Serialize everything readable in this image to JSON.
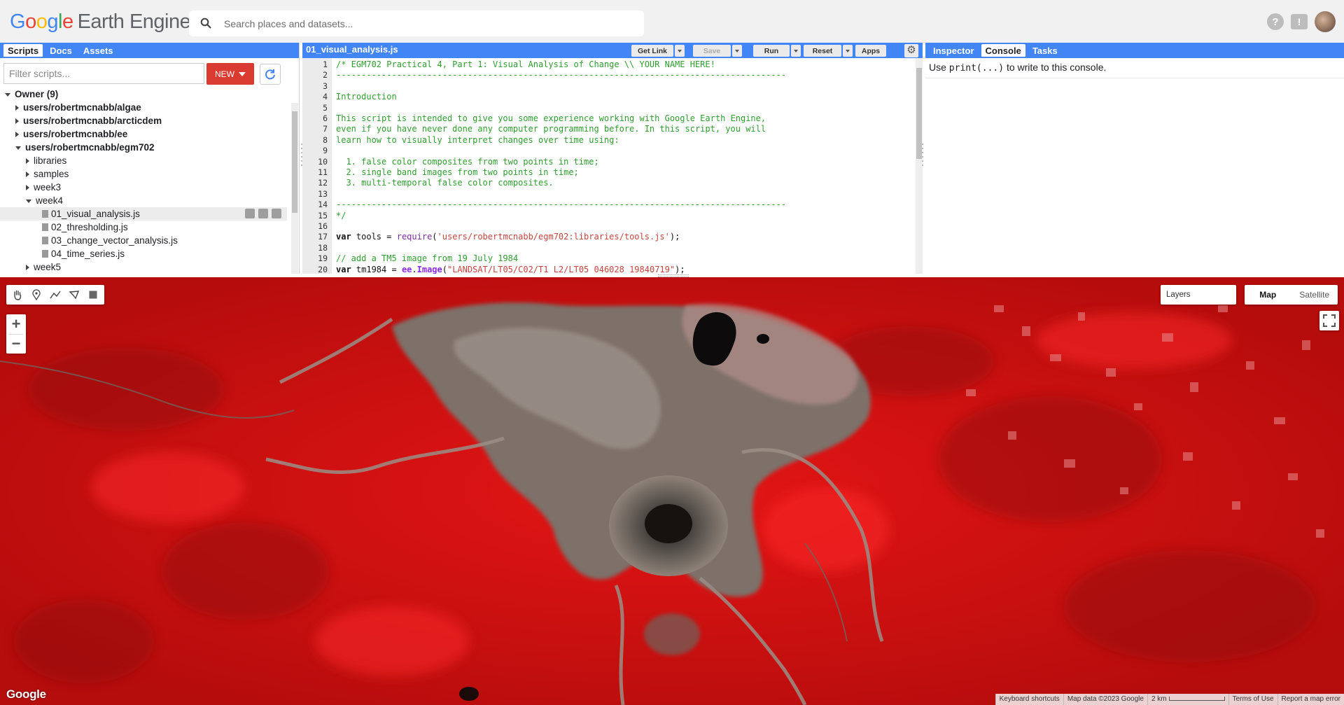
{
  "app": {
    "logo_google": [
      "G",
      "o",
      "o",
      "g",
      "l",
      "e"
    ],
    "logo_product": "Earth Engine",
    "search_placeholder": "Search places and datasets..."
  },
  "left_panel": {
    "tabs": [
      "Scripts",
      "Docs",
      "Assets"
    ],
    "active_tab": "Scripts",
    "filter_placeholder": "Filter scripts...",
    "new_label": "NEW",
    "tree": [
      {
        "label": "Owner (9)",
        "depth": 0,
        "state": "open",
        "bold": true,
        "kind": "folder"
      },
      {
        "label": "users/robertmcnabb/algae",
        "depth": 1,
        "state": "closed",
        "bold": true,
        "kind": "folder"
      },
      {
        "label": "users/robertmcnabb/arcticdem",
        "depth": 1,
        "state": "closed",
        "bold": true,
        "kind": "folder"
      },
      {
        "label": "users/robertmcnabb/ee",
        "depth": 1,
        "state": "closed",
        "bold": true,
        "kind": "folder"
      },
      {
        "label": "users/robertmcnabb/egm702",
        "depth": 1,
        "state": "open",
        "bold": true,
        "kind": "folder"
      },
      {
        "label": "libraries",
        "depth": 2,
        "state": "closed",
        "bold": false,
        "kind": "folder"
      },
      {
        "label": "samples",
        "depth": 2,
        "state": "closed",
        "bold": false,
        "kind": "folder"
      },
      {
        "label": "week3",
        "depth": 2,
        "state": "closed",
        "bold": false,
        "kind": "folder"
      },
      {
        "label": "week4",
        "depth": 2,
        "state": "open",
        "bold": false,
        "kind": "folder"
      },
      {
        "label": "01_visual_analysis.js",
        "depth": 3,
        "state": "file",
        "bold": false,
        "kind": "file",
        "selected": true
      },
      {
        "label": "02_thresholding.js",
        "depth": 3,
        "state": "file",
        "bold": false,
        "kind": "file"
      },
      {
        "label": "03_change_vector_analysis.js",
        "depth": 3,
        "state": "file",
        "bold": false,
        "kind": "file"
      },
      {
        "label": "04_time_series.js",
        "depth": 3,
        "state": "file",
        "bold": false,
        "kind": "file"
      },
      {
        "label": "week5",
        "depth": 2,
        "state": "closed",
        "bold": false,
        "kind": "folder"
      }
    ]
  },
  "editor": {
    "filename": "01_visual_analysis.js",
    "buttons": {
      "get_link": "Get Link",
      "save": "Save",
      "run": "Run",
      "reset": "Reset",
      "apps": "Apps"
    },
    "lines": [
      [
        {
          "t": "/* EGM702 Practical 4, Part 1: Visual Analysis of Change \\\\ YOUR NAME HERE!",
          "c": "cm"
        }
      ],
      [
        {
          "t": "-----------------------------------------------------------------------------------------",
          "c": "cm"
        }
      ],
      [],
      [
        {
          "t": "Introduction",
          "c": "cm"
        }
      ],
      [],
      [
        {
          "t": "This script is intended to give you some experience working with Google Earth Engine,",
          "c": "cm"
        }
      ],
      [
        {
          "t": "even if you have never done any computer programming before. In this script, you will",
          "c": "cm"
        }
      ],
      [
        {
          "t": "learn how to visually interpret changes over time using:",
          "c": "cm"
        }
      ],
      [],
      [
        {
          "t": "  1. false color composites from two points in time;",
          "c": "cm"
        }
      ],
      [
        {
          "t": "  2. single band images from two points in time;",
          "c": "cm"
        }
      ],
      [
        {
          "t": "  3. multi-temporal false color composites.",
          "c": "cm"
        }
      ],
      [],
      [
        {
          "t": "-----------------------------------------------------------------------------------------",
          "c": "cm"
        }
      ],
      [
        {
          "t": "*/",
          "c": "cm"
        }
      ],
      [],
      [
        {
          "t": "var",
          "c": "kw"
        },
        {
          "t": " tools = ",
          "c": "pl"
        },
        {
          "t": "require",
          "c": "fn"
        },
        {
          "t": "(",
          "c": "pl"
        },
        {
          "t": "'users/robertmcnabb/egm702:libraries/tools.js'",
          "c": "st"
        },
        {
          "t": ");",
          "c": "pl"
        }
      ],
      [],
      [
        {
          "t": "// add a TM5 image from 19 July 1984",
          "c": "cm"
        }
      ],
      [
        {
          "t": "var",
          "c": "kw"
        },
        {
          "t": " tm1984 = ",
          "c": "pl"
        },
        {
          "t": "ee",
          "c": "ee"
        },
        {
          "t": ".",
          "c": "pl"
        },
        {
          "t": "Image",
          "c": "ee"
        },
        {
          "t": "(",
          "c": "pl"
        },
        {
          "t": "\"LANDSAT/LT05/C02/T1_L2/LT05_046028_19840719\"",
          "c": "st"
        },
        {
          "t": ");",
          "c": "pl"
        }
      ]
    ]
  },
  "right_panel": {
    "tabs": [
      "Inspector",
      "Console",
      "Tasks"
    ],
    "active_tab": "Console",
    "console_hint_pre": "Use ",
    "console_hint_code": "print(...)",
    "console_hint_post": " to write to this console."
  },
  "map": {
    "layers_label": "Layers",
    "map_types": [
      "Map",
      "Satellite"
    ],
    "active_map_type": "Map",
    "zoom_in": "+",
    "zoom_out": "−",
    "google_logo": "Google",
    "attribution": {
      "shortcuts": "Keyboard shortcuts",
      "map_data": "Map data ©2023 Google",
      "scale": "2 km",
      "terms": "Terms of Use",
      "report": "Report a map error"
    },
    "draw_tools": [
      "hand-icon",
      "marker-icon",
      "line-icon",
      "polygon-icon",
      "rectangle-icon"
    ]
  },
  "colors": {
    "brand_blue": "#4285f4",
    "new_red": "#d93b31",
    "code_comment": "#2e9e2e",
    "code_string": "#c3453d",
    "code_fn": "#7a2da0",
    "map_red": "#d81111"
  }
}
